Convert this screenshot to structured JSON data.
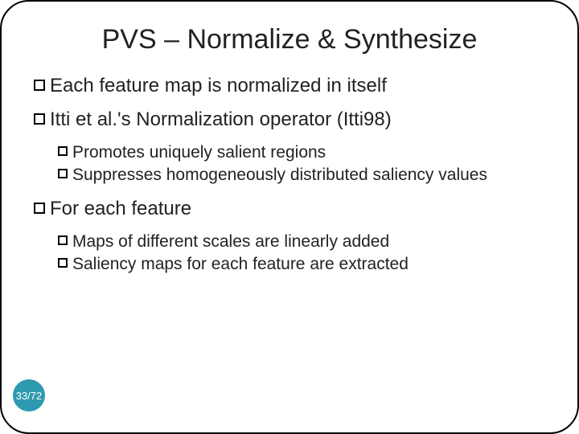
{
  "title": "PVS – Normalize & Synthesize",
  "bullets": {
    "b1": "Each feature map is normalized in itself",
    "b2": "Itti et al.'s Normalization operator (Itti98)",
    "b2_sub": {
      "s1": "Promotes uniquely salient regions",
      "s2": "Suppresses homogeneously distributed saliency values"
    },
    "b3": "For each feature",
    "b3_sub": {
      "s1": "Maps of different scales are linearly added",
      "s2": "Saliency maps for each feature are extracted"
    }
  },
  "page_indicator": "33/72"
}
